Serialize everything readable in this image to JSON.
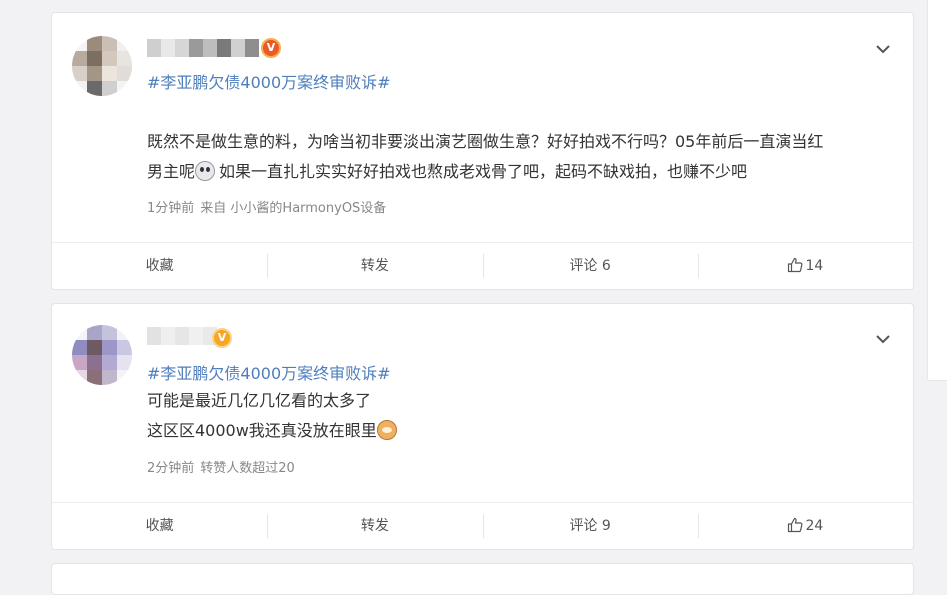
{
  "posts": [
    {
      "topic": "#李亚鹏欠债4000万案终审败诉#",
      "lines": [
        "既然不是做生意的料，为啥当初非要淡出演艺圈做生意？好好拍戏不行吗？05年前后一直演当红",
        "男主呢",
        "如果一直扎扎实实好好拍戏也熬成老戏骨了吧，起码不缺戏拍，也赚不少吧"
      ],
      "emoji": "panda-emoji",
      "time": "1分钟前",
      "source": "来自 小小酱的HarmonyOS设备",
      "actions": {
        "favorite": "收藏",
        "repost": "转发",
        "comment": "评论 6",
        "like": "14"
      },
      "avatar_colors": [
        "#f4f4f4",
        "#9c8a7a",
        "#c9bfb5",
        "#f0f0f0",
        "#b8aa9c",
        "#7d6e62",
        "#d4c8bd",
        "#e8e4e0",
        "#d8d0c8",
        "#a59585",
        "#ebe5de",
        "#e0dcd8",
        "#f2f2f2",
        "#6a6a6a",
        "#cfcfcf",
        "#f4f4f4"
      ],
      "name_colors": [
        "#cfcfcf",
        "#e8e8e8",
        "#d6d6d6",
        "#9a9a9a",
        "#bdbdbd",
        "#7a7a7a",
        "#d0d0d0",
        "#8e8e8e"
      ],
      "badge": "V"
    },
    {
      "topic": "#李亚鹏欠债4000万案终审败诉#",
      "lines": [
        "可能是最近几亿几亿看的太多了",
        "这区区4000w我还真没放在眼里"
      ],
      "emoji": "cat-emoji",
      "time": "2分钟前",
      "source": "转赞人数超过20",
      "actions": {
        "favorite": "收藏",
        "repost": "转发",
        "comment": "评论 9",
        "like": "24"
      },
      "avatar_colors": [
        "#f4f4f8",
        "#a7a6c8",
        "#c4c2dc",
        "#f2f2f6",
        "#8f8cc0",
        "#6e5a62",
        "#9d97c7",
        "#c9c7e2",
        "#c8a6c6",
        "#8b7090",
        "#b3aad4",
        "#e6e2f0",
        "#e8d8e6",
        "#8a6f78",
        "#c1b7cc",
        "#f4f4f6"
      ],
      "name_colors": [
        "#e2e2e2",
        "#efefef",
        "#e6e6e6",
        "#f0f0f0",
        "#e9e9e9"
      ],
      "badge": "V"
    }
  ]
}
